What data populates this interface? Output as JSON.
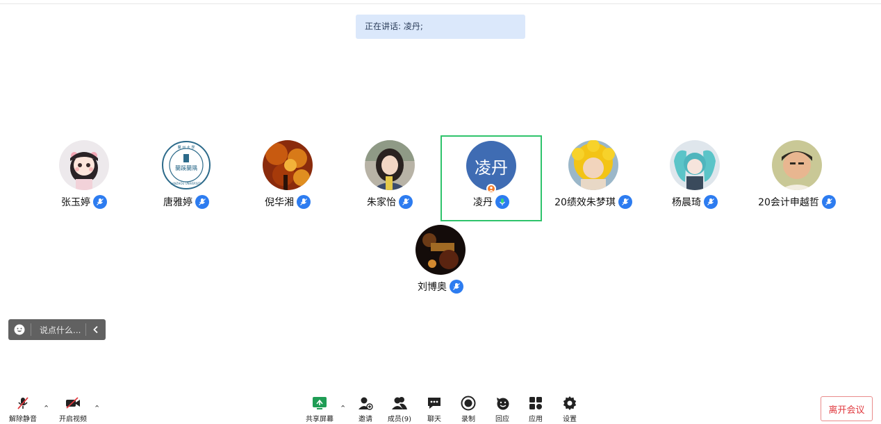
{
  "banner": {
    "speaking_text": "正在讲话: 凌丹;"
  },
  "participants": [
    {
      "name": "张玉婷"
    },
    {
      "name": "唐雅婷"
    },
    {
      "name": "倪华湘"
    },
    {
      "name": "朱家怡"
    },
    {
      "name": "凌丹",
      "avatar_text": "凌丹"
    },
    {
      "name": "20绩效朱梦琪"
    },
    {
      "name": "杨晨琦"
    },
    {
      "name": "20会计申越哲"
    },
    {
      "name": "刘博奥"
    }
  ],
  "logo_text": {
    "top": "蘭 州 大 學",
    "middle": "蘭蹊蘭隅",
    "bottom": "LANZHOU UNIVERSITY"
  },
  "chat": {
    "placeholder": "说点什么..."
  },
  "toolbar": {
    "unmute": "解除静音",
    "start_video": "开启视频",
    "share_screen": "共享屏幕",
    "invite": "邀请",
    "members": "成员(9)",
    "chat": "聊天",
    "record": "录制",
    "reactions": "回应",
    "apps": "应用",
    "settings": "设置",
    "leave": "离开会议"
  },
  "colors": {
    "accent_blue": "#2d7cf0",
    "active_border": "#2ec36b",
    "leave_red": "#e0393e",
    "host_orange": "#f47d2c"
  }
}
